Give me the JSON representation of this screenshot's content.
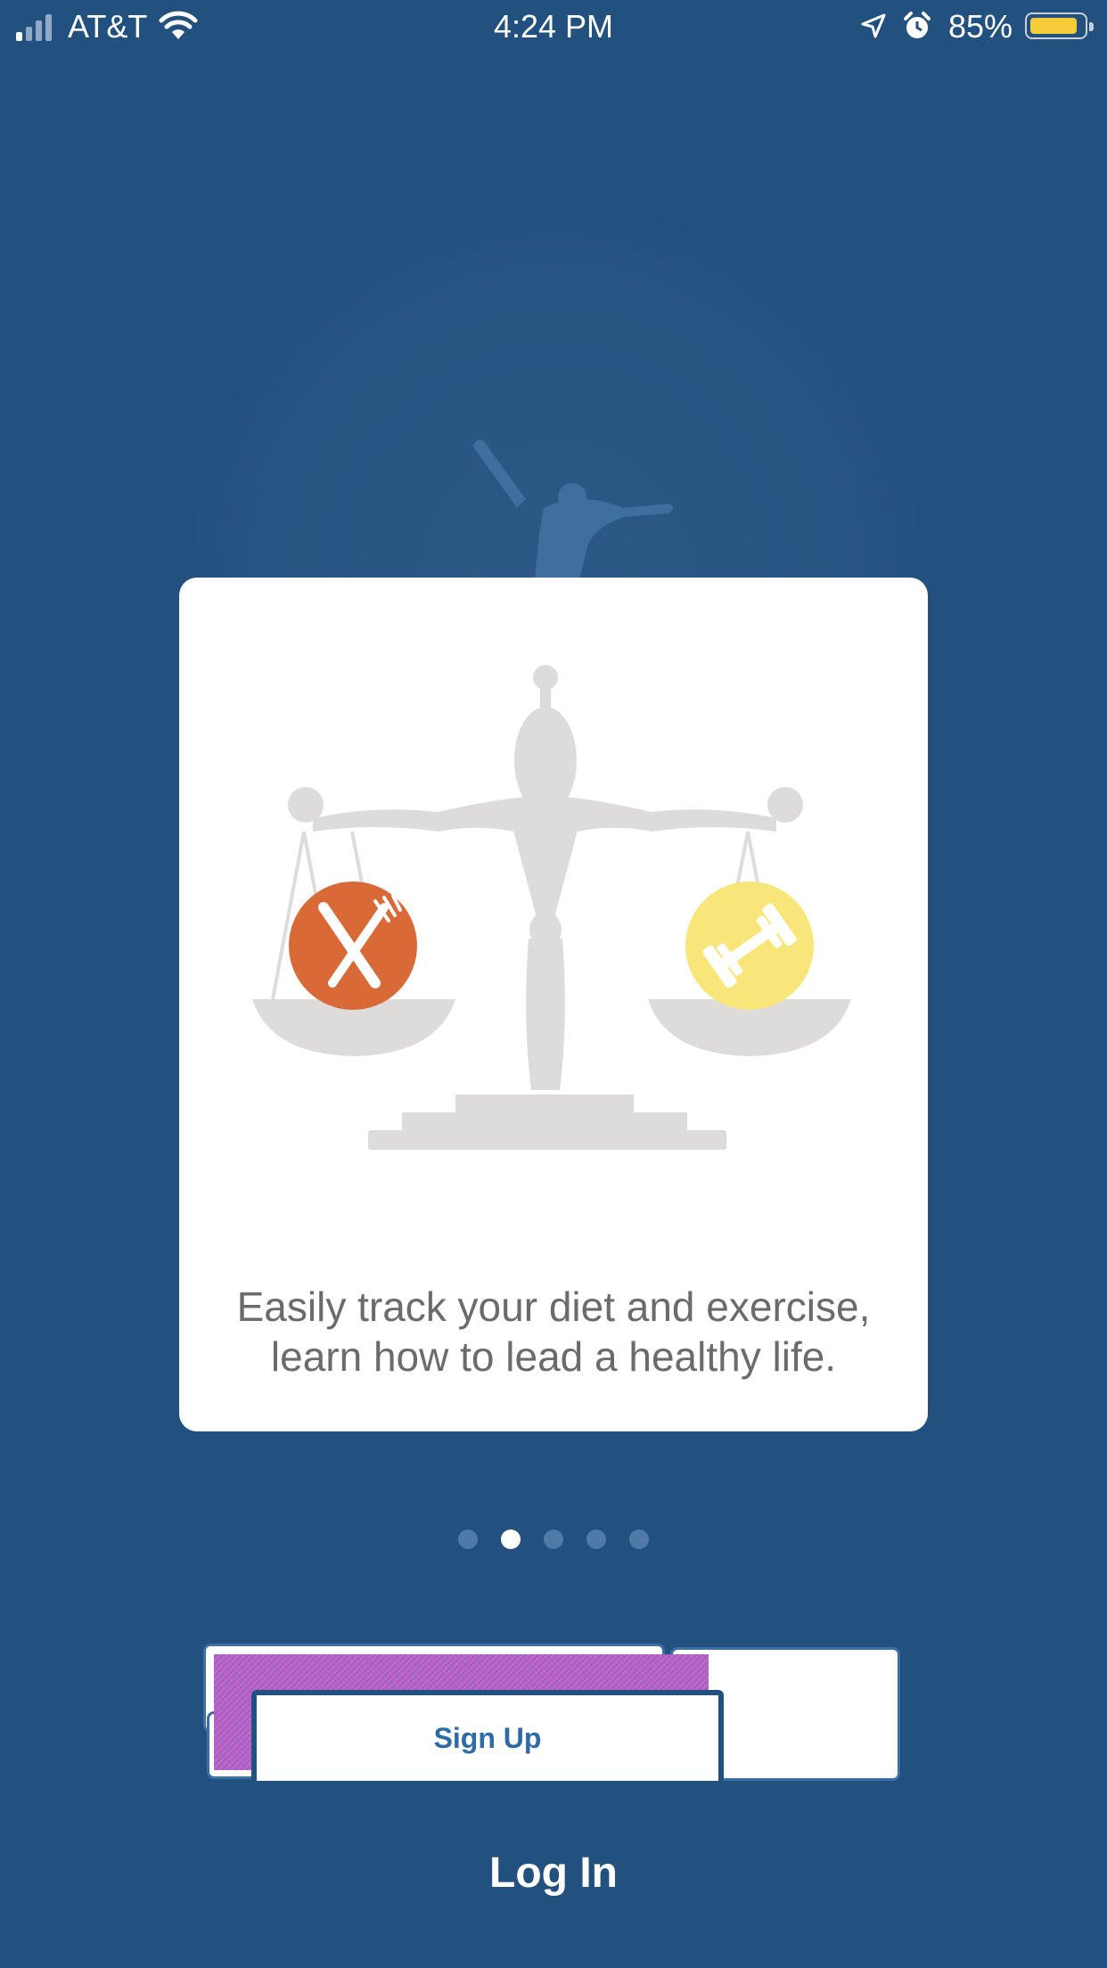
{
  "status_bar": {
    "carrier": "AT&T",
    "time": "4:24 PM",
    "battery_percent": "85%",
    "battery_level": 0.85,
    "icons": [
      "signal-icon",
      "wifi-icon",
      "location-arrow-icon",
      "alarm-icon",
      "battery-icon"
    ]
  },
  "onboarding": {
    "illustration": "balance-scale-icon",
    "left_icon": "fork-knife-icon",
    "right_icon": "dumbbell-icon",
    "caption_line1": "Easily track your diet and exercise,",
    "caption_line2": "learn how to lead a healthy life.",
    "page_count": 5,
    "active_page": 2
  },
  "actions": {
    "signup_label": "Sign Up",
    "login_label": "Log In"
  },
  "colors": {
    "background": "#22507f",
    "card": "#ffffff",
    "scale_gray": "#dedbdb",
    "food_orange": "#d96a38",
    "exercise_yellow": "#f9e67a",
    "button_text": "#2e6aa6",
    "battery_yellow": "#f5cc3a"
  }
}
